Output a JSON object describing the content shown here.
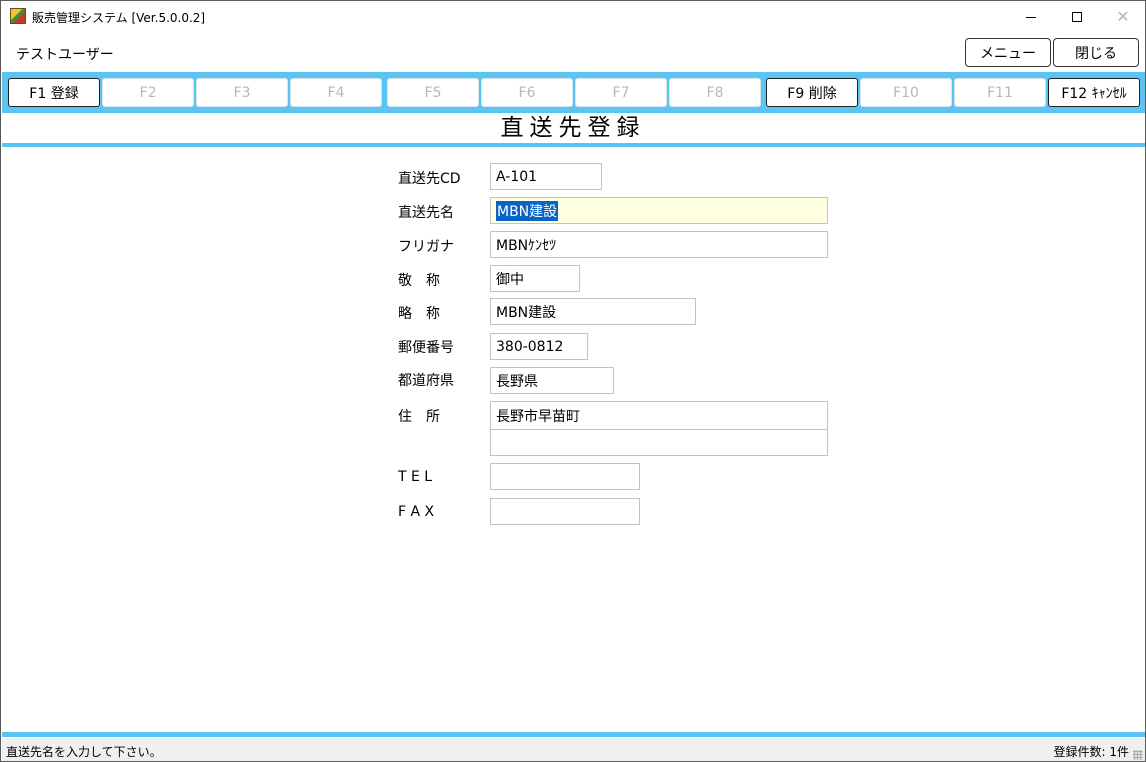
{
  "window": {
    "title": "販売管理システム [Ver.5.0.0.2]",
    "controls": {
      "minimize": "—",
      "maximize": "☐",
      "close": "✕"
    }
  },
  "header": {
    "user_name": "テストユーザー",
    "menu_button": "メニュー",
    "close_button": "閉じる"
  },
  "function_keys": [
    {
      "label": "F1 登録",
      "enabled": true
    },
    {
      "label": "F2",
      "enabled": false
    },
    {
      "label": "F3",
      "enabled": false
    },
    {
      "label": "F4",
      "enabled": false
    },
    {
      "label": "F5",
      "enabled": false
    },
    {
      "label": "F6",
      "enabled": false
    },
    {
      "label": "F7",
      "enabled": false
    },
    {
      "label": "F8",
      "enabled": false
    },
    {
      "label": "F9 削除",
      "enabled": true
    },
    {
      "label": "F10",
      "enabled": false
    },
    {
      "label": "F11",
      "enabled": false
    },
    {
      "label": "F12 ｷｬﾝｾﾙ",
      "enabled": true
    }
  ],
  "page_title": "直送先登録",
  "form": {
    "code": {
      "label": "直送先CD",
      "value": "A-101"
    },
    "name": {
      "label": "直送先名",
      "value": "MBN建設"
    },
    "furigana": {
      "label": "フリガナ",
      "value": "MBNｹﾝｾﾂ"
    },
    "honorific": {
      "label": "敬　称",
      "value": "御中"
    },
    "short_name": {
      "label": "略　称",
      "value": "MBN建設"
    },
    "postal_code": {
      "label": "郵便番号",
      "value": "380-0812"
    },
    "prefecture": {
      "label": "都道府県",
      "value": "長野県"
    },
    "address": {
      "label": "住　所",
      "line1": "長野市早苗町",
      "line2": ""
    },
    "tel": {
      "label": "T E L",
      "value": ""
    },
    "fax": {
      "label": "F A X",
      "value": ""
    }
  },
  "status": {
    "message": "直送先名を入力して下さい。",
    "record_count": "登録件数: 1件"
  },
  "colors": {
    "accent_bar": "#5cc4f2",
    "active_field": "#ffffe1",
    "selection": "#0a64c8"
  }
}
